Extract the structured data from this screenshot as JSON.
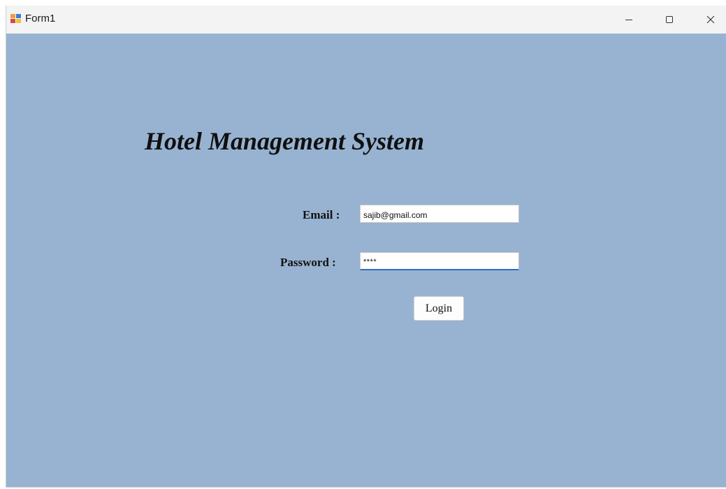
{
  "window": {
    "title": "Form1",
    "app_icon": "winforms-form-icon",
    "controls": {
      "minimize_icon": "minimize-icon",
      "maximize_icon": "maximize-icon",
      "close_icon": "close-icon"
    }
  },
  "form": {
    "heading": "Hotel Management System",
    "email_label": "Email :",
    "email_value": "sajib@gmail.com",
    "password_label": "Password :",
    "password_value": "****",
    "login_label": "Login"
  },
  "colors": {
    "form_background": "#98b3d1",
    "titlebar_background": "#f3f3f3",
    "focus_accent": "#2a6fc4"
  }
}
